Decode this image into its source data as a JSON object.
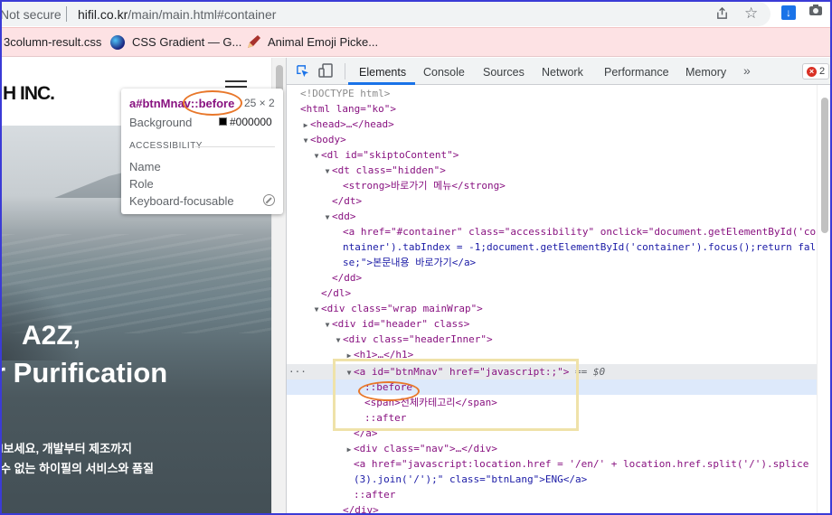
{
  "browser": {
    "security": "Not secure",
    "url_host": "hifil.co.kr",
    "url_path": "/main/main.html#container",
    "bookmarks": [
      {
        "label": "3column-result.css"
      },
      {
        "label": "CSS Gradient — G..."
      },
      {
        "label": "Animal Emoji Picke..."
      }
    ]
  },
  "page": {
    "logo": "H INC.",
    "hero_title_1": "A2Z,",
    "hero_title_2": "r Purification",
    "hero_sub_1": "l보세요, 개발부터 제조까지",
    "hero_sub_2": "수 없는 하이필의 서비스와 품질"
  },
  "tooltip": {
    "selector": "a#btnMnav",
    "pseudo": "::before",
    "size": "25 × 2",
    "background_label": "Background",
    "background_value": "#000000",
    "section": "ACCESSIBILITY",
    "name_label": "Name",
    "role_label": "Role",
    "keyboard_label": "Keyboard-focusable"
  },
  "devtools": {
    "tabs": [
      "Elements",
      "Console",
      "Sources",
      "Network",
      "Performance",
      "Memory"
    ],
    "active_tab": "Elements",
    "more": "»",
    "error_count": "2",
    "lines": [
      "<!DOCTYPE html>",
      "<html lang=\"ko\">",
      "<head>…</head>",
      "<body>",
      "<dl id=\"skiptoContent\">",
      "<dt class=\"hidden\">",
      "<strong>바로가기 메뉴</strong>",
      "</dt>",
      "<dd>",
      "<a href=\"#container\" class=\"accessibility\" onclick=\"document.getElementById('co",
      "ntainer').tabIndex = -1;document.getElementById('container').focus();return fal",
      "se;\">본문내용 바로가기</a>",
      "</dd>",
      "</dl>",
      "<div class=\"wrap mainWrap\">",
      "<div id=\"header\" class>",
      "<div class=\"headerInner\">",
      "<h1>…</h1>",
      "<a id=\"btnMnav\" href=\"javascript:;\">",
      "== $0",
      "::before",
      "<span>전체카테고리</span>",
      "::after",
      "</a>",
      "<div class=\"nav\">…</div>",
      "<a href=\"javascript:location.href = '/en/' + location.href.split('/').splice",
      "(3).join('/');\" class=\"btnLang\">ENG</a>",
      "::after",
      "</div>"
    ]
  },
  "colors": {
    "bookmark_bar": "#fde2e4",
    "accent": "#1a73e8",
    "annotation_orange": "#e8772a",
    "annotation_yellow": "#efe2a9",
    "frame": "#3b3bd6"
  }
}
